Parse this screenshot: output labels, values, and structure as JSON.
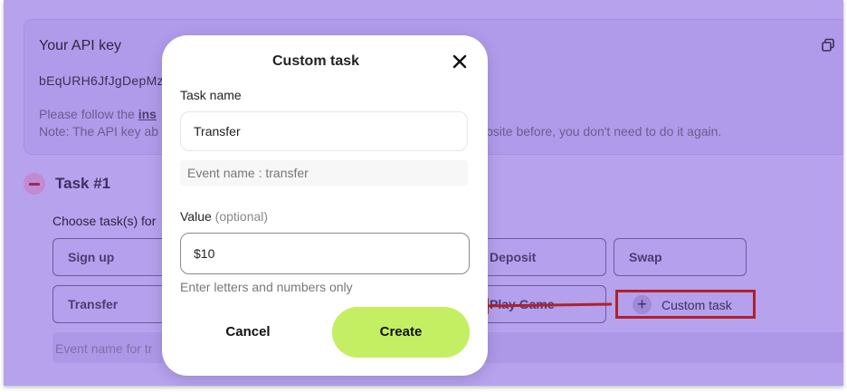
{
  "api_card": {
    "title": "Your API key",
    "key_value": "bEqURH6JfJgDepMz",
    "note_prefix": "Please follow the ",
    "note_link": "ins",
    "note2_start": "Note: The API key ab",
    "note2_tail": "bsite before, you don't need to do it again."
  },
  "task": {
    "title": "Task #1",
    "choose_label": "Choose task(s) for",
    "buttons": {
      "sign_up": "Sign up",
      "deposit": "Deposit",
      "swap": "Swap",
      "transfer": "Transfer",
      "play_game": "Play Game",
      "custom_task": "Custom task"
    },
    "event_placeholder": "Event name for tr"
  },
  "modal": {
    "title": "Custom task",
    "task_name_label": "Task name",
    "task_name_value": "Transfer",
    "event_hint": "Event name : transfer",
    "value_label": "Value",
    "value_optional": "(optional)",
    "value_value": "$10",
    "value_hint": "Enter letters and numbers only",
    "cancel_label": "Cancel",
    "create_label": "Create"
  },
  "colors": {
    "overlay_bg": "#b7a2ee",
    "accent_create": "#c4ef63",
    "annotation_red": "#b0212a"
  },
  "icons": [
    "copy-icon",
    "minus-icon",
    "plus-icon",
    "close-icon",
    "arrow-annotation"
  ]
}
